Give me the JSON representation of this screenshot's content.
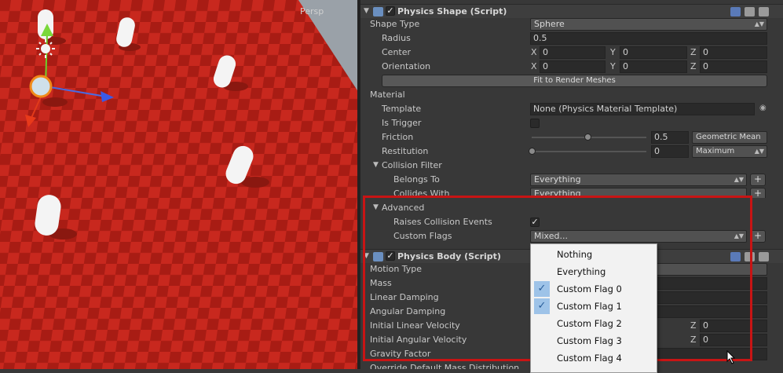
{
  "scene": {
    "view_label": "Persp"
  },
  "physics_shape": {
    "title": "Physics Shape (Script)",
    "shape_type": {
      "label": "Shape Type",
      "value": "Sphere"
    },
    "radius": {
      "label": "Radius",
      "value": "0.5"
    },
    "center": {
      "label": "Center",
      "x": "0",
      "y": "0",
      "z": "0"
    },
    "orientation": {
      "label": "Orientation",
      "x": "0",
      "y": "0",
      "z": "0"
    },
    "fit_button": "Fit to Render Meshes",
    "material_label": "Material",
    "template": {
      "label": "Template",
      "value": "None (Physics Material Template)"
    },
    "is_trigger": {
      "label": "Is Trigger",
      "checked": false
    },
    "friction": {
      "label": "Friction",
      "value": "0.5",
      "combine": "Geometric Mean",
      "fraction": 0.5
    },
    "restitution": {
      "label": "Restitution",
      "value": "0",
      "combine": "Maximum",
      "fraction": 0
    },
    "collision_filter": {
      "label": "Collision Filter",
      "belongs_to": {
        "label": "Belongs To",
        "value": "Everything"
      },
      "collides_with": {
        "label": "Collides With",
        "value": "Everything"
      }
    },
    "advanced": {
      "label": "Advanced",
      "raises": {
        "label": "Raises Collision Events",
        "checked": true
      },
      "custom_flags": {
        "label": "Custom Flags",
        "value": "Mixed..."
      }
    }
  },
  "physics_body": {
    "title": "Physics Body (Script)",
    "fields": [
      "Motion Type",
      "Mass",
      "Linear Damping",
      "Angular Damping",
      "Initial Linear Velocity",
      "Initial Angular Velocity",
      "Gravity Factor",
      "Override Default Mass Distribution"
    ],
    "z_label": "Z",
    "initial_linear_z": "0",
    "initial_angular_z": "0"
  },
  "axis_labels": {
    "x": "X",
    "y": "Y",
    "z": "Z"
  },
  "dropdown_menu": {
    "items": [
      {
        "label": "Nothing",
        "checked": false
      },
      {
        "label": "Everything",
        "checked": false
      },
      {
        "label": "Custom Flag 0",
        "checked": true
      },
      {
        "label": "Custom Flag 1",
        "checked": true
      },
      {
        "label": "Custom Flag 2",
        "checked": false
      },
      {
        "label": "Custom Flag 3",
        "checked": false
      },
      {
        "label": "Custom Flag 4",
        "checked": false
      }
    ]
  },
  "icons": [
    "script-icon",
    "book-icon",
    "settings-icon",
    "gear-icon",
    "foldout-arrow-icon",
    "object-picker-icon",
    "checkmark-icon",
    "mouse-cursor-icon",
    "move-gizmo-icon",
    "light-icon"
  ],
  "colors": {
    "highlight_box": "#c81414",
    "floor_red": "#c8281e",
    "floor_dark": "#a81c14",
    "menu_check": "#9ec3e8"
  }
}
